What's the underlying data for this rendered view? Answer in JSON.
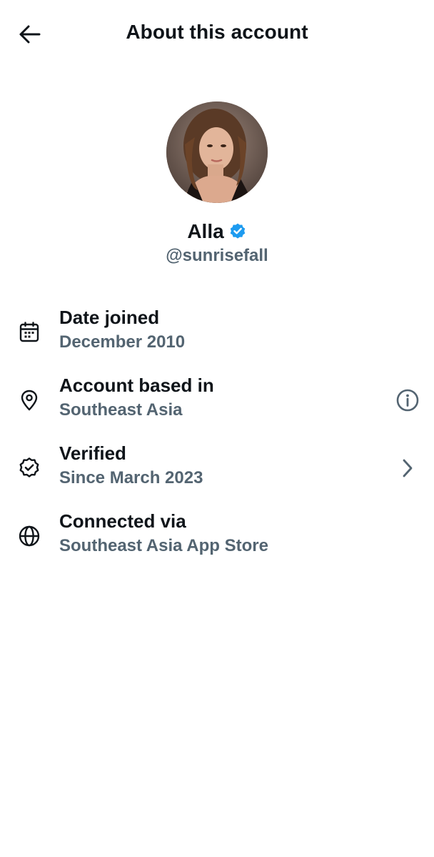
{
  "header": {
    "title": "About this account",
    "back_icon": "arrow-left-icon"
  },
  "profile": {
    "name": "Alla",
    "handle": "@sunrisefall",
    "verified_badge_color": "#1d9bf0"
  },
  "rows": [
    {
      "title": "Date joined",
      "value": "December 2010",
      "icon": "calendar-icon"
    },
    {
      "title": "Account based in",
      "value": "Southeast Asia",
      "icon": "location-pin-icon",
      "action_icon": "info-icon"
    },
    {
      "title": "Verified",
      "value": "Since March 2023",
      "icon": "verified-badge-icon",
      "action_icon": "chevron-right-icon"
    },
    {
      "title": "Connected via",
      "value": "Southeast Asia App Store",
      "icon": "globe-icon"
    }
  ],
  "colors": {
    "primary_text": "#0f1419",
    "secondary_text": "#536471",
    "accent": "#1d9bf0"
  }
}
